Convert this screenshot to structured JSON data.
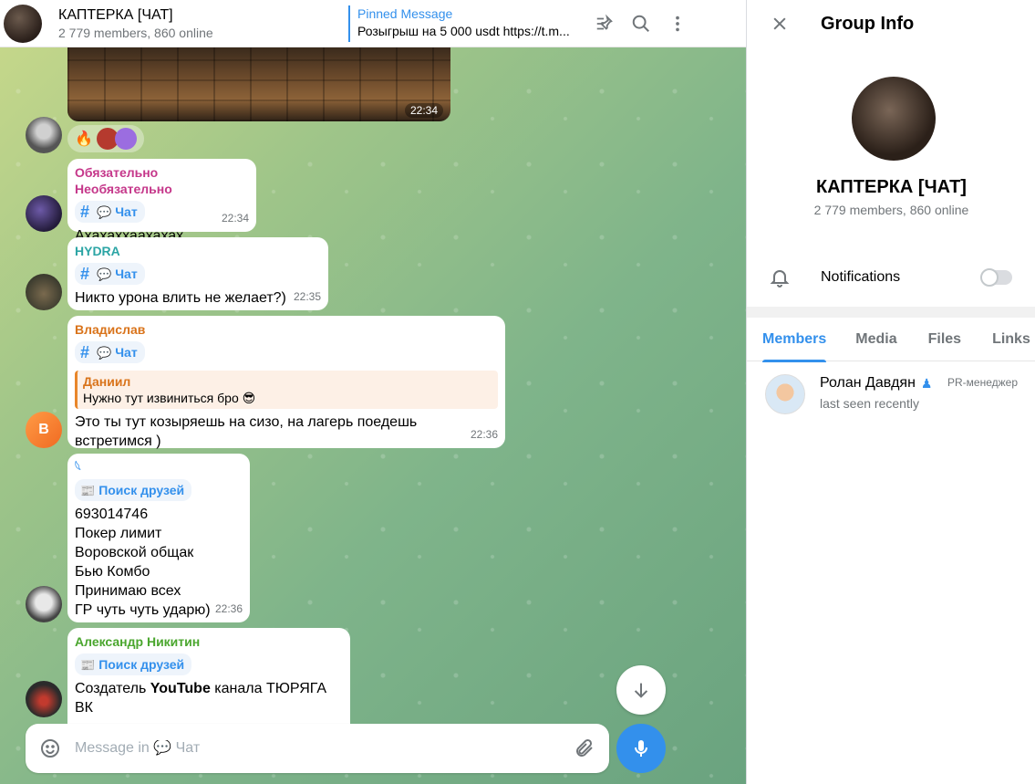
{
  "header": {
    "title": "КАПТЕРКА [ЧАТ]",
    "subtitle": "2 779 members, 860 online",
    "pinned_label": "Pinned Message",
    "pinned_text": "Розыгрыш на 5 000 usdt https://t.m..."
  },
  "photo_time": "22:34",
  "reactions": {
    "emoji": "🔥"
  },
  "messages": [
    {
      "author": "Обязательно Необязательно",
      "author_color": "#c5378a",
      "topic": "Чат",
      "text": "Ахахаххаахахах",
      "time": "22:34"
    },
    {
      "author": "HYDRA",
      "author_color": "#2ca5a5",
      "topic": "Чат",
      "text": "Никто урона влить не желает?)",
      "time": "22:35"
    },
    {
      "author": "Владислав",
      "author_color": "#d9731a",
      "topic": "Чат",
      "reply_author": "Даниил",
      "reply_text": "Нужно тут извиниться бро 😎",
      "text": "Это ты тут козыряешь на сизо, на лагерь поедешь встретимся )",
      "time": "22:36",
      "avatar_letter": "В"
    },
    {
      "author": "𓆩",
      "author_color": "#3390ec",
      "topic": "Поиск друзей",
      "text": "693014746\nПокер лимит\nВоровской общак\nБью Комбо\nПринимаю всех\nГР чуть чуть ударю)",
      "time": "22:36"
    },
    {
      "author": "Александр Никитин",
      "author_color": "#4aa62e",
      "topic": "Поиск друзей",
      "text_prefix": "Создатель ",
      "text_bold": "YouTube",
      "text_suffix": " канала ТЮРЯГА ВК"
    }
  ],
  "composer": {
    "placeholder": "Message in 💬 Чат"
  },
  "info": {
    "title": "Group Info",
    "name": "КАПТЕРКА [ЧАТ]",
    "subtitle": "2 779 members, 860 online",
    "notifications_label": "Notifications",
    "notifications_on": false,
    "tabs": [
      "Members",
      "Media",
      "Files",
      "Links"
    ],
    "active_tab": "Members",
    "member": {
      "name": "Ролан Давдян",
      "status": "last seen recently",
      "role": "PR-менеджер"
    }
  },
  "colors": {
    "accent": "#3390ec",
    "bubble": "#ffffff",
    "chat_bg": "#8fbf86"
  }
}
